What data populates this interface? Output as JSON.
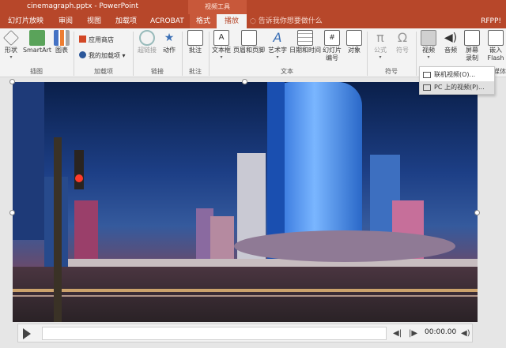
{
  "window": {
    "title": "cinemagraph.pptx - PowerPoint",
    "context_tab_group": "视频工具",
    "user": "RFPP!"
  },
  "tabs": [
    {
      "label": "幻灯片放映",
      "active": false
    },
    {
      "label": "审阅",
      "active": false
    },
    {
      "label": "视图",
      "active": false
    },
    {
      "label": "加载项",
      "active": false
    },
    {
      "label": "ACROBAT",
      "active": false
    },
    {
      "label": "格式",
      "active": false,
      "contextual": true
    },
    {
      "label": "播放",
      "active": true,
      "contextual": true
    }
  ],
  "tell_me": "告诉我你想要做什么",
  "ribbon": {
    "shape_label": "形状",
    "smartart_label": "SmartArt",
    "chart_label": "图表",
    "illustrations_group": "插图",
    "store_label": "应用商店",
    "my_addins_label": "我的加载项",
    "addins_group": "加载项",
    "link_label": "超链接",
    "action_label": "动作",
    "links_group": "链接",
    "comment_label": "批注",
    "comments_group": "批注",
    "textbox_label": "文本框",
    "header_footer_label": "页眉和页脚",
    "wordart_label": "艺术字",
    "datetime_label": "日期和时间",
    "slide_number_label_1": "幻灯片",
    "slide_number_label_2": "编号",
    "object_label": "对象",
    "text_group": "文本",
    "equation_label": "公式",
    "symbol_label": "符号",
    "symbols_group": "符号",
    "video_label": "视频",
    "audio_label": "音频",
    "screen_recording_label_1": "屏幕",
    "screen_recording_label_2": "录制",
    "embed_flash_label_1": "嵌入",
    "embed_flash_label_2": "Flash",
    "media_group": "媒体"
  },
  "video_menu": {
    "items": [
      {
        "label": "联机视频(O)..."
      },
      {
        "label": "PC 上的视频(P)..."
      }
    ]
  },
  "player": {
    "time": "00:00.00"
  },
  "colors": {
    "accent": "#b7472a",
    "ribbon_bg": "#f3f3f3"
  }
}
